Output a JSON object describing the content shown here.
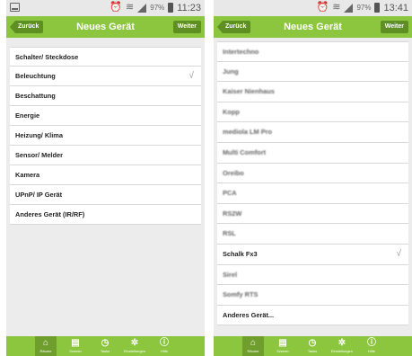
{
  "left": {
    "status": {
      "battery": "97%",
      "time": "11:23"
    },
    "nav": {
      "back": "Zurück",
      "title": "Neues Gerät",
      "next": "Weiter"
    },
    "items": [
      "Schalter/ Steckdose",
      "Beleuchtung",
      "Beschattung",
      "Energie",
      "Heizung/ Klima",
      "Sensor/ Melder",
      "Kamera",
      "UPnP/ IP Gerät",
      "Anderes Gerät (IR/RF)"
    ],
    "checked_item": "Beleuchtung",
    "check_mark": "√"
  },
  "right": {
    "status": {
      "battery": "97%",
      "time": "13:41"
    },
    "nav": {
      "back": "Zurück",
      "title": "Neues Gerät",
      "next": "Weiter"
    },
    "items": [
      "Intertechno",
      "Jung",
      "Kaiser Nienhaus",
      "Kopp",
      "mediola LM Pro",
      "Multi Comfort",
      "Oreibo",
      "PCA",
      "RS2W",
      "RSL",
      "Schalk Fx3",
      "Sirel",
      "Somfy RTS",
      "Anderes Gerät..."
    ],
    "checked_item": "Schalk Fx3",
    "check_mark": "√"
  },
  "tabbar": {
    "tabs": [
      {
        "label": "Räume",
        "icon": "rooms-icon",
        "glyph": "⌂",
        "active": true
      },
      {
        "label": "Szenen",
        "icon": "scenes-icon",
        "glyph": "▤",
        "active": false
      },
      {
        "label": "Tasks",
        "icon": "clock-icon",
        "glyph": "◷",
        "active": false
      },
      {
        "label": "Einstellungen",
        "icon": "settings-icon",
        "glyph": "✲",
        "active": false
      },
      {
        "label": "Hilfe",
        "icon": "info-icon",
        "glyph": "ⓘ",
        "active": false
      }
    ]
  },
  "colors": {
    "accent": "#8cc63e",
    "accent_dark": "#5e8f22",
    "tab_active": "#6f9e2c"
  }
}
